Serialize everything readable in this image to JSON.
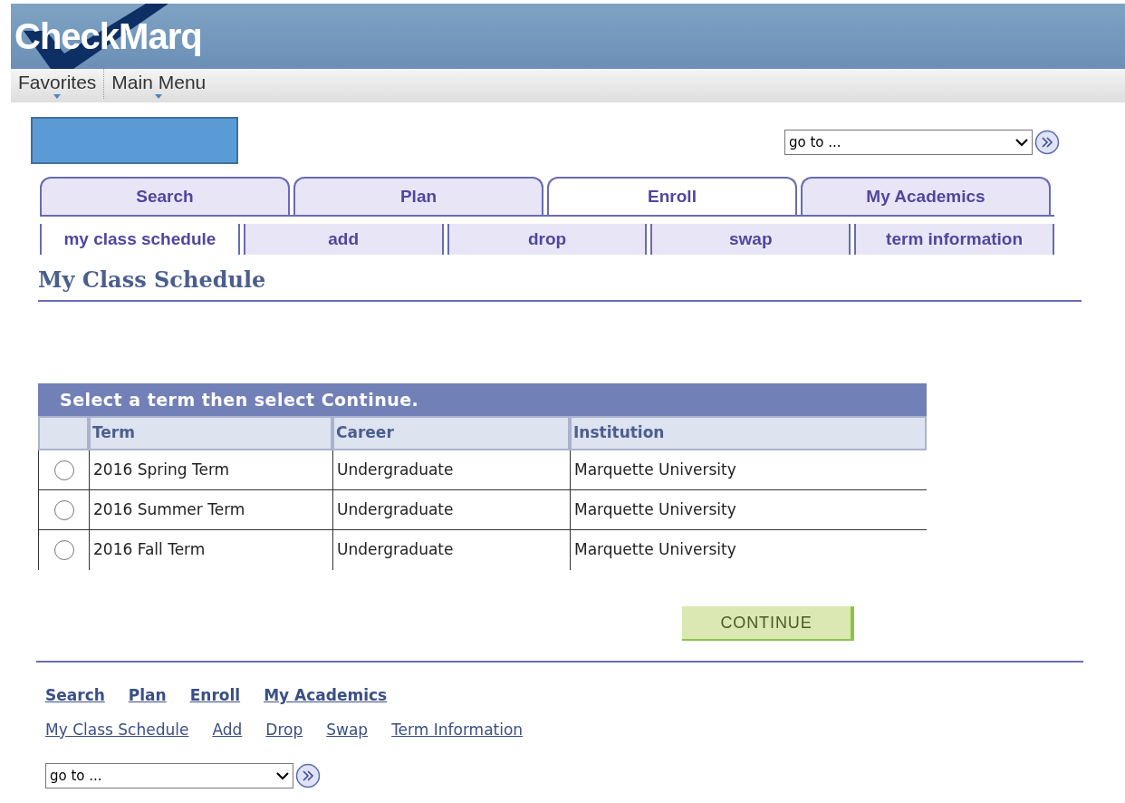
{
  "header": {
    "logo": "CheckMarq"
  },
  "menu": [
    {
      "label": "Favorites"
    },
    {
      "label": "Main Menu"
    }
  ],
  "goto_top": {
    "value": "go to ..."
  },
  "tabs": [
    {
      "label": "Search",
      "selected": false
    },
    {
      "label": "Plan",
      "selected": false
    },
    {
      "label": "Enroll",
      "selected": true
    },
    {
      "label": "My Academics",
      "selected": false
    }
  ],
  "subtabs": [
    {
      "label": "my class schedule",
      "selected": true
    },
    {
      "label": "add",
      "selected": false
    },
    {
      "label": "drop",
      "selected": false
    },
    {
      "label": "swap",
      "selected": false
    },
    {
      "label": "term information",
      "selected": false
    }
  ],
  "page_title": "My Class Schedule",
  "table": {
    "caption": "Select a term then select Continue.",
    "columns": [
      "Term",
      "Career",
      "Institution"
    ],
    "rows": [
      {
        "selected": false,
        "cells": [
          "2016 Spring Term",
          "Undergraduate",
          "Marquette University"
        ]
      },
      {
        "selected": false,
        "cells": [
          "2016 Summer Term",
          "Undergraduate",
          "Marquette University"
        ]
      },
      {
        "selected": false,
        "cells": [
          "2016 Fall Term",
          "Undergraduate",
          "Marquette University"
        ]
      }
    ]
  },
  "continue_button": "CONTINUE",
  "footer_links": [
    "Search",
    "Plan",
    "Enroll",
    "My Academics"
  ],
  "footer_sublinks": [
    "My Class Schedule",
    "Add",
    "Drop",
    "Swap",
    "Term Information"
  ],
  "goto_bottom": {
    "value": "go to ..."
  }
}
